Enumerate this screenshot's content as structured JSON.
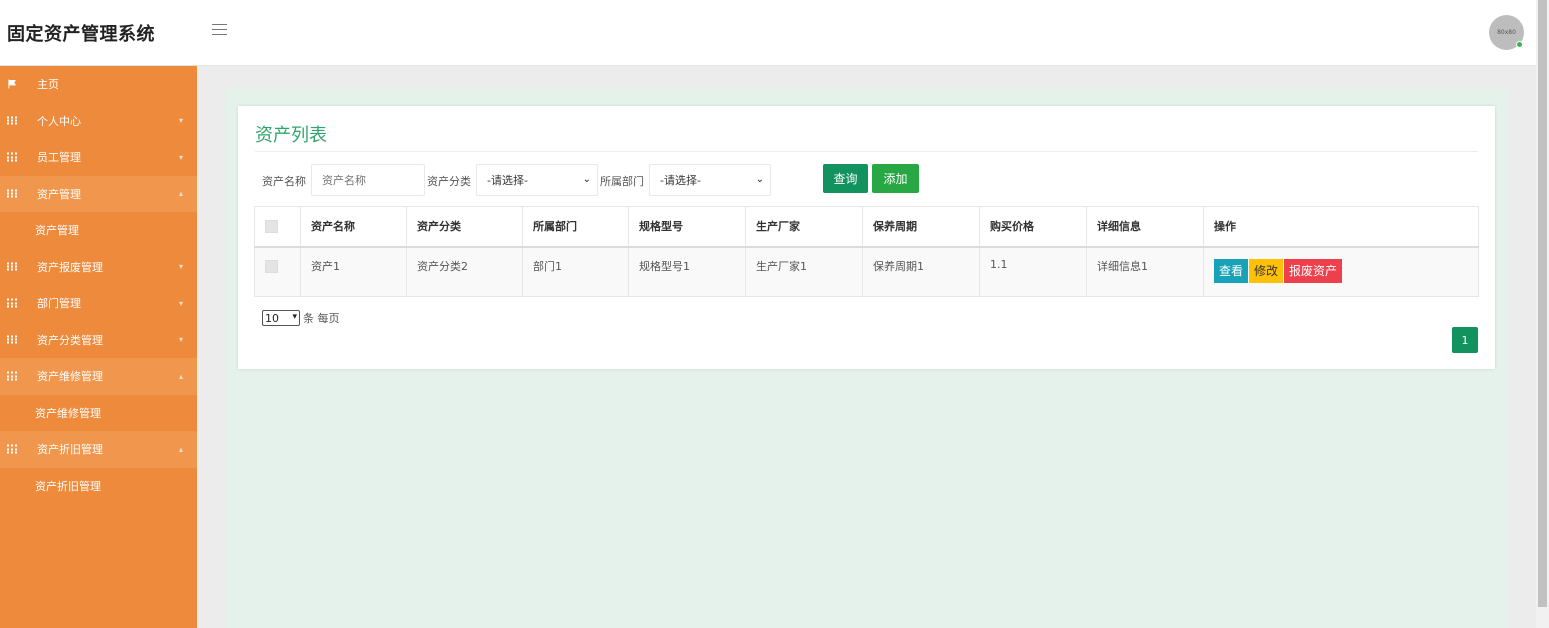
{
  "header": {
    "title": "固定资产管理系统",
    "avatar_text": "80x80"
  },
  "sidebar": {
    "items": [
      {
        "label": "主页",
        "icon": "flag-icon"
      },
      {
        "label": "个人中心",
        "caret": "▾"
      },
      {
        "label": "员工管理",
        "caret": "▾"
      },
      {
        "label": "资产管理",
        "caret": "▴",
        "sub": "资产管理"
      },
      {
        "label": "资产报废管理",
        "caret": "▾"
      },
      {
        "label": "部门管理",
        "caret": "▾"
      },
      {
        "label": "资产分类管理",
        "caret": "▾"
      },
      {
        "label": "资产维修管理",
        "caret": "▴",
        "sub": "资产维修管理"
      },
      {
        "label": "资产折旧管理",
        "caret": "▴",
        "sub": "资产折旧管理"
      }
    ]
  },
  "main": {
    "title": "资产列表",
    "search": {
      "name_label": "资产名称",
      "name_placeholder": "资产名称",
      "category_label": "资产分类",
      "category_value": "-请选择-",
      "dept_label": "所属部门",
      "dept_value": "-请选择-",
      "query_button": "查询",
      "add_button": "添加"
    },
    "table": {
      "headers": [
        "资产名称",
        "资产分类",
        "所属部门",
        "规格型号",
        "生产厂家",
        "保养周期",
        "购买价格",
        "详细信息",
        "操作"
      ],
      "rows": [
        {
          "name": "资产1",
          "category": "资产分类2",
          "dept": "部门1",
          "model": "规格型号1",
          "maker": "生产厂家1",
          "cycle": "保养周期1",
          "price": "1.1",
          "detail": "详细信息1",
          "actions": {
            "view": "查看",
            "edit": "修改",
            "scrap": "报废资产"
          }
        }
      ]
    },
    "page_size": "10",
    "page_size_suffix": "条 每页",
    "current_page": "1"
  },
  "colors": {
    "sidebar": "#ee8a3c",
    "accent_green": "#12925e",
    "title_green": "#2fa66b",
    "view": "#17a2b8",
    "edit": "#ffc107",
    "scrap": "#ee3f4d"
  }
}
